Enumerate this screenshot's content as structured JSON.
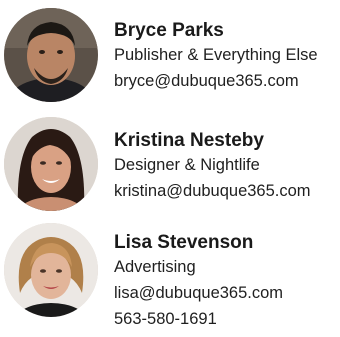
{
  "staff": [
    {
      "name": "Bryce Parks",
      "role": "Publisher & Everything Else",
      "email": "bryce@dubuque365.com",
      "phone": ""
    },
    {
      "name": "Kristina Nesteby",
      "role": "Designer & Nightlife",
      "email": "kristina@dubuque365.com",
      "phone": ""
    },
    {
      "name": "Lisa Stevenson",
      "role": "Advertising",
      "email": "lisa@dubuque365.com",
      "phone": "563-580-1691"
    }
  ]
}
